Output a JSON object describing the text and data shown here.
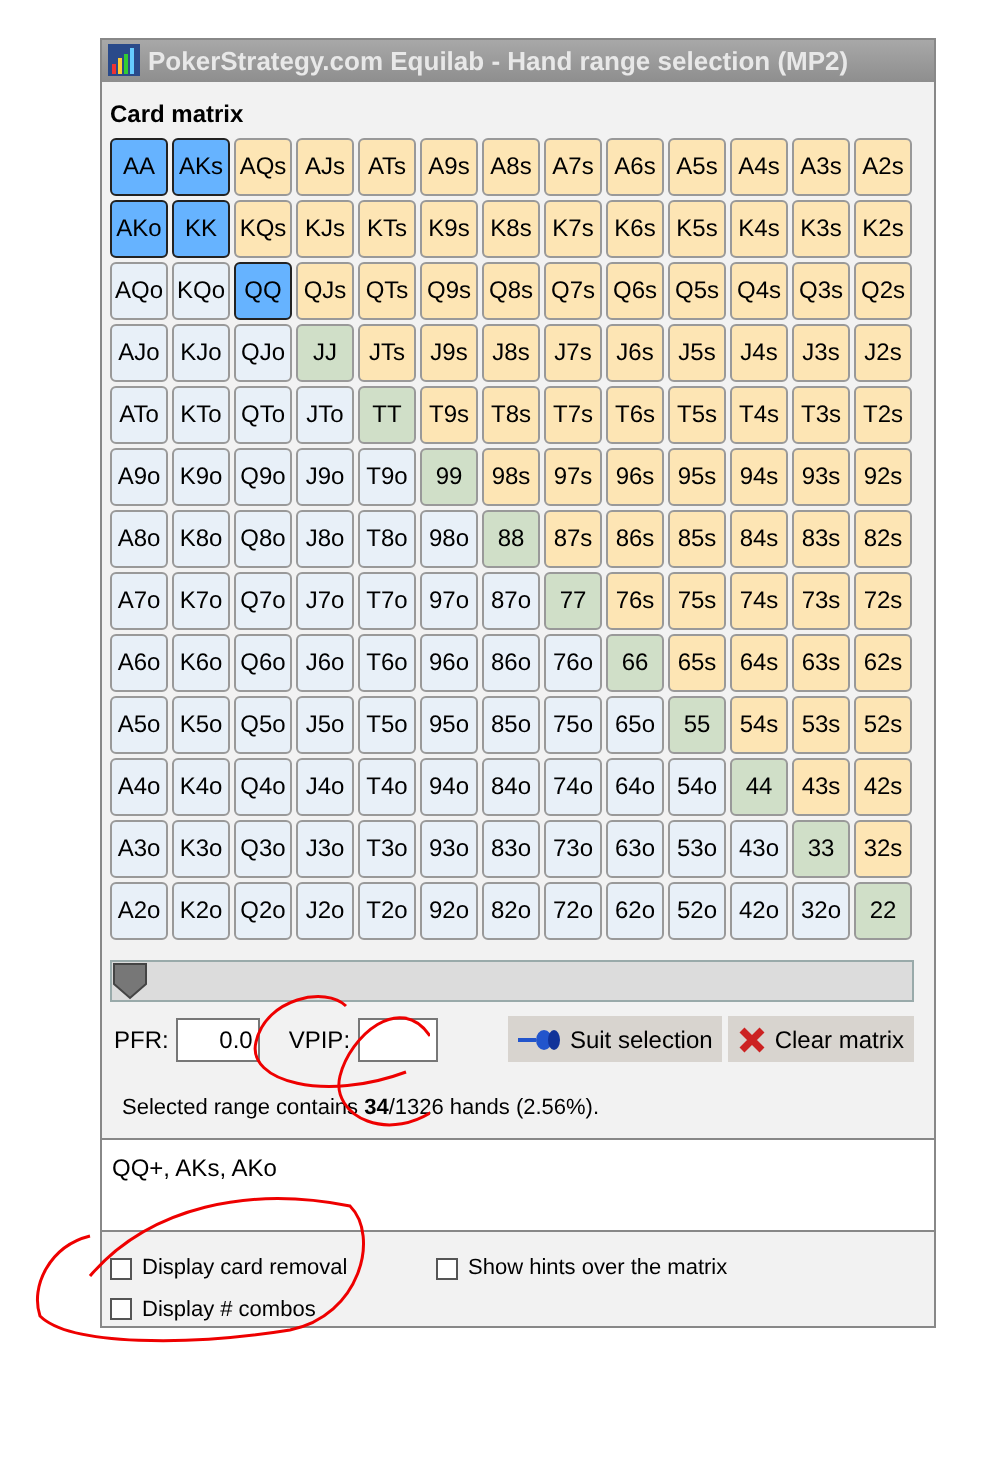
{
  "window": {
    "title": "PokerStrategy.com Equilab - Hand range selection (MP2)"
  },
  "card_matrix": {
    "title": "Card matrix",
    "rows": [
      [
        {
          "label": "AA",
          "selected": true
        },
        {
          "label": "AKs",
          "selected": true
        },
        {
          "label": "AQs",
          "selected": false
        },
        {
          "label": "AJs",
          "selected": false
        },
        {
          "label": "ATs",
          "selected": false
        },
        {
          "label": "A9s",
          "selected": false
        },
        {
          "label": "A8s",
          "selected": false
        },
        {
          "label": "A7s",
          "selected": false
        },
        {
          "label": "A6s",
          "selected": false
        },
        {
          "label": "A5s",
          "selected": false
        },
        {
          "label": "A4s",
          "selected": false
        },
        {
          "label": "A3s",
          "selected": false
        },
        {
          "label": "A2s",
          "selected": false
        }
      ],
      [
        {
          "label": "AKo",
          "selected": true
        },
        {
          "label": "KK",
          "selected": true
        },
        {
          "label": "KQs",
          "selected": false
        },
        {
          "label": "KJs",
          "selected": false
        },
        {
          "label": "KTs",
          "selected": false
        },
        {
          "label": "K9s",
          "selected": false
        },
        {
          "label": "K8s",
          "selected": false
        },
        {
          "label": "K7s",
          "selected": false
        },
        {
          "label": "K6s",
          "selected": false
        },
        {
          "label": "K5s",
          "selected": false
        },
        {
          "label": "K4s",
          "selected": false
        },
        {
          "label": "K3s",
          "selected": false
        },
        {
          "label": "K2s",
          "selected": false
        }
      ],
      [
        {
          "label": "AQo",
          "selected": false
        },
        {
          "label": "KQo",
          "selected": false
        },
        {
          "label": "QQ",
          "selected": true
        },
        {
          "label": "QJs",
          "selected": false
        },
        {
          "label": "QTs",
          "selected": false
        },
        {
          "label": "Q9s",
          "selected": false
        },
        {
          "label": "Q8s",
          "selected": false
        },
        {
          "label": "Q7s",
          "selected": false
        },
        {
          "label": "Q6s",
          "selected": false
        },
        {
          "label": "Q5s",
          "selected": false
        },
        {
          "label": "Q4s",
          "selected": false
        },
        {
          "label": "Q3s",
          "selected": false
        },
        {
          "label": "Q2s",
          "selected": false
        }
      ],
      [
        {
          "label": "AJo",
          "selected": false
        },
        {
          "label": "KJo",
          "selected": false
        },
        {
          "label": "QJo",
          "selected": false
        },
        {
          "label": "JJ",
          "selected": false
        },
        {
          "label": "JTs",
          "selected": false
        },
        {
          "label": "J9s",
          "selected": false
        },
        {
          "label": "J8s",
          "selected": false
        },
        {
          "label": "J7s",
          "selected": false
        },
        {
          "label": "J6s",
          "selected": false
        },
        {
          "label": "J5s",
          "selected": false
        },
        {
          "label": "J4s",
          "selected": false
        },
        {
          "label": "J3s",
          "selected": false
        },
        {
          "label": "J2s",
          "selected": false
        }
      ],
      [
        {
          "label": "ATo",
          "selected": false
        },
        {
          "label": "KTo",
          "selected": false
        },
        {
          "label": "QTo",
          "selected": false
        },
        {
          "label": "JTo",
          "selected": false
        },
        {
          "label": "TT",
          "selected": false
        },
        {
          "label": "T9s",
          "selected": false
        },
        {
          "label": "T8s",
          "selected": false
        },
        {
          "label": "T7s",
          "selected": false
        },
        {
          "label": "T6s",
          "selected": false
        },
        {
          "label": "T5s",
          "selected": false
        },
        {
          "label": "T4s",
          "selected": false
        },
        {
          "label": "T3s",
          "selected": false
        },
        {
          "label": "T2s",
          "selected": false
        }
      ],
      [
        {
          "label": "A9o",
          "selected": false
        },
        {
          "label": "K9o",
          "selected": false
        },
        {
          "label": "Q9o",
          "selected": false
        },
        {
          "label": "J9o",
          "selected": false
        },
        {
          "label": "T9o",
          "selected": false
        },
        {
          "label": "99",
          "selected": false
        },
        {
          "label": "98s",
          "selected": false
        },
        {
          "label": "97s",
          "selected": false
        },
        {
          "label": "96s",
          "selected": false
        },
        {
          "label": "95s",
          "selected": false
        },
        {
          "label": "94s",
          "selected": false
        },
        {
          "label": "93s",
          "selected": false
        },
        {
          "label": "92s",
          "selected": false
        }
      ],
      [
        {
          "label": "A8o",
          "selected": false
        },
        {
          "label": "K8o",
          "selected": false
        },
        {
          "label": "Q8o",
          "selected": false
        },
        {
          "label": "J8o",
          "selected": false
        },
        {
          "label": "T8o",
          "selected": false
        },
        {
          "label": "98o",
          "selected": false
        },
        {
          "label": "88",
          "selected": false
        },
        {
          "label": "87s",
          "selected": false
        },
        {
          "label": "86s",
          "selected": false
        },
        {
          "label": "85s",
          "selected": false
        },
        {
          "label": "84s",
          "selected": false
        },
        {
          "label": "83s",
          "selected": false
        },
        {
          "label": "82s",
          "selected": false
        }
      ],
      [
        {
          "label": "A7o",
          "selected": false
        },
        {
          "label": "K7o",
          "selected": false
        },
        {
          "label": "Q7o",
          "selected": false
        },
        {
          "label": "J7o",
          "selected": false
        },
        {
          "label": "T7o",
          "selected": false
        },
        {
          "label": "97o",
          "selected": false
        },
        {
          "label": "87o",
          "selected": false
        },
        {
          "label": "77",
          "selected": false
        },
        {
          "label": "76s",
          "selected": false
        },
        {
          "label": "75s",
          "selected": false
        },
        {
          "label": "74s",
          "selected": false
        },
        {
          "label": "73s",
          "selected": false
        },
        {
          "label": "72s",
          "selected": false
        }
      ],
      [
        {
          "label": "A6o",
          "selected": false
        },
        {
          "label": "K6o",
          "selected": false
        },
        {
          "label": "Q6o",
          "selected": false
        },
        {
          "label": "J6o",
          "selected": false
        },
        {
          "label": "T6o",
          "selected": false
        },
        {
          "label": "96o",
          "selected": false
        },
        {
          "label": "86o",
          "selected": false
        },
        {
          "label": "76o",
          "selected": false
        },
        {
          "label": "66",
          "selected": false
        },
        {
          "label": "65s",
          "selected": false
        },
        {
          "label": "64s",
          "selected": false
        },
        {
          "label": "63s",
          "selected": false
        },
        {
          "label": "62s",
          "selected": false
        }
      ],
      [
        {
          "label": "A5o",
          "selected": false
        },
        {
          "label": "K5o",
          "selected": false
        },
        {
          "label": "Q5o",
          "selected": false
        },
        {
          "label": "J5o",
          "selected": false
        },
        {
          "label": "T5o",
          "selected": false
        },
        {
          "label": "95o",
          "selected": false
        },
        {
          "label": "85o",
          "selected": false
        },
        {
          "label": "75o",
          "selected": false
        },
        {
          "label": "65o",
          "selected": false
        },
        {
          "label": "55",
          "selected": false
        },
        {
          "label": "54s",
          "selected": false
        },
        {
          "label": "53s",
          "selected": false
        },
        {
          "label": "52s",
          "selected": false
        }
      ],
      [
        {
          "label": "A4o",
          "selected": false
        },
        {
          "label": "K4o",
          "selected": false
        },
        {
          "label": "Q4o",
          "selected": false
        },
        {
          "label": "J4o",
          "selected": false
        },
        {
          "label": "T4o",
          "selected": false
        },
        {
          "label": "94o",
          "selected": false
        },
        {
          "label": "84o",
          "selected": false
        },
        {
          "label": "74o",
          "selected": false
        },
        {
          "label": "64o",
          "selected": false
        },
        {
          "label": "54o",
          "selected": false
        },
        {
          "label": "44",
          "selected": false
        },
        {
          "label": "43s",
          "selected": false
        },
        {
          "label": "42s",
          "selected": false
        }
      ],
      [
        {
          "label": "A3o",
          "selected": false
        },
        {
          "label": "K3o",
          "selected": false
        },
        {
          "label": "Q3o",
          "selected": false
        },
        {
          "label": "J3o",
          "selected": false
        },
        {
          "label": "T3o",
          "selected": false
        },
        {
          "label": "93o",
          "selected": false
        },
        {
          "label": "83o",
          "selected": false
        },
        {
          "label": "73o",
          "selected": false
        },
        {
          "label": "63o",
          "selected": false
        },
        {
          "label": "53o",
          "selected": false
        },
        {
          "label": "43o",
          "selected": false
        },
        {
          "label": "33",
          "selected": false
        },
        {
          "label": "32s",
          "selected": false
        }
      ],
      [
        {
          "label": "A2o",
          "selected": false
        },
        {
          "label": "K2o",
          "selected": false
        },
        {
          "label": "Q2o",
          "selected": false
        },
        {
          "label": "J2o",
          "selected": false
        },
        {
          "label": "T2o",
          "selected": false
        },
        {
          "label": "92o",
          "selected": false
        },
        {
          "label": "82o",
          "selected": false
        },
        {
          "label": "72o",
          "selected": false
        },
        {
          "label": "62o",
          "selected": false
        },
        {
          "label": "52o",
          "selected": false
        },
        {
          "label": "42o",
          "selected": false
        },
        {
          "label": "32o",
          "selected": false
        },
        {
          "label": "22",
          "selected": false
        }
      ]
    ]
  },
  "range_slider": {
    "level": 0
  },
  "pfr": {
    "label": "PFR:",
    "value": "0.0"
  },
  "vpip": {
    "label": "VPIP:"
  },
  "buttons": [
    {
      "kind": "suit",
      "label": "Suit selection"
    },
    {
      "kind": "clear",
      "label": "Clear matrix"
    }
  ],
  "summary": "Selected range contains **34**/1326 hands (2.56%).",
  "range_text": "QQ+, AKs, AKo",
  "options": [
    {
      "label": "Display card removal",
      "checked": false
    },
    {
      "label": "Show hints over the matrix",
      "checked": false
    },
    {
      "label": "Display # combos",
      "checked": false
    }
  ]
}
